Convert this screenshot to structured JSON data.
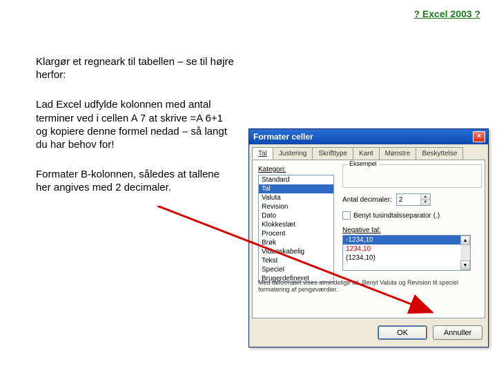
{
  "header": {
    "link": "? Excel 2003 ?"
  },
  "paragraphs": {
    "p1": "Klargør et regneark til tabellen – se til højre herfor:",
    "p2": "Lad Excel udfylde kolonnen med antal terminer ved i cellen A 7 at skrive =A 6+1 og kopiere denne formel nedad – så langt du har behov for!",
    "p3": "Formater B-kolonnen, således at tallene her angives med 2 decimaler."
  },
  "dialog": {
    "title": "Formater celler",
    "close": "×",
    "tabs": [
      "Tal",
      "Justering",
      "Skrifttype",
      "Kant",
      "Mønstre",
      "Beskyttelse"
    ],
    "kategori_label": "Kategori:",
    "categories": [
      "Standard",
      "Tal",
      "Valuta",
      "Revision",
      "Dato",
      "Klokkeslæt",
      "Procent",
      "Brøk",
      "Videnskabelig",
      "Tekst",
      "Speciel",
      "Brugerdefineret"
    ],
    "selected_category_index": 1,
    "eksempel_legend": "Eksempel",
    "decimals_label": "Antal decimaler:",
    "decimals_value": "2",
    "thousand_sep": "Benyt tusindtalsseparator (.)",
    "negative_label": "Negative tal:",
    "negative_options": [
      "-1234,10",
      "1234,10",
      "(1234,10)"
    ],
    "negative_selected": 0,
    "help": "Med talformatet vises almindelige tal. Benyt Valuta og Revision til speciel formatering af pengeværdier.",
    "ok": "OK",
    "cancel": "Annuller"
  }
}
